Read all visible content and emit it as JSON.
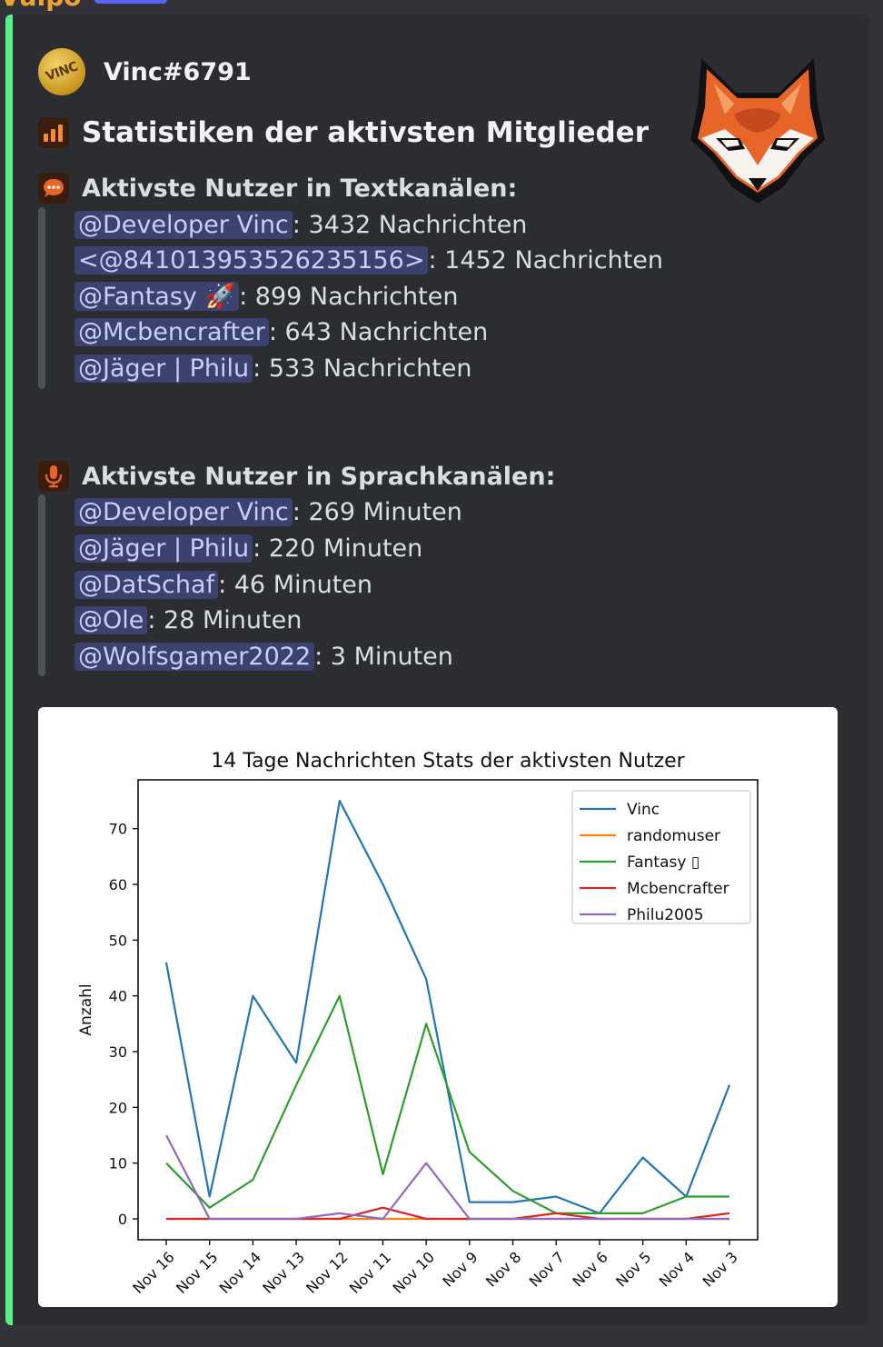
{
  "author": {
    "name": "Vinc#6791",
    "avatar_text": "VINC"
  },
  "embed": {
    "accent_color": "#57f287",
    "title": "Statistiken der aktivsten Mitglieder",
    "text_section": {
      "heading": "Aktivste Nutzer in Textkanälen:",
      "entries": [
        {
          "mention": "@Developer Vinc",
          "value": ": 3432 Nachrichten"
        },
        {
          "mention": "<@841013953526235156>",
          "value": ": 1452 Nachrichten"
        },
        {
          "mention": "@Fantasy 🚀",
          "value": ": 899 Nachrichten"
        },
        {
          "mention": "@Mcbencrafter",
          "value": ": 643 Nachrichten"
        },
        {
          "mention": "@Jäger | Philu",
          "value": ": 533 Nachrichten"
        }
      ]
    },
    "voice_section": {
      "heading": "Aktivste Nutzer in Sprachkanälen:",
      "entries": [
        {
          "mention": "@Developer Vinc",
          "value": ": 269 Minuten"
        },
        {
          "mention": "@Jäger | Philu",
          "value": ": 220 Minuten"
        },
        {
          "mention": "@DatSchaf",
          "value": ": 46 Minuten"
        },
        {
          "mention": "@Ole",
          "value": ": 28 Minuten"
        },
        {
          "mention": "@Wolfsgamer2022",
          "value": ": 3 Minuten"
        }
      ]
    }
  },
  "chart_data": {
    "type": "line",
    "title": "14 Tage Nachrichten Stats der aktivsten Nutzer",
    "xlabel": "",
    "ylabel": "Anzahl",
    "categories": [
      "Nov 16",
      "Nov 15",
      "Nov 14",
      "Nov 13",
      "Nov 12",
      "Nov 11",
      "Nov 10",
      "Nov 9",
      "Nov 8",
      "Nov 7",
      "Nov 6",
      "Nov 5",
      "Nov 4",
      "Nov 3"
    ],
    "yticks": [
      0,
      10,
      20,
      30,
      40,
      50,
      60,
      70
    ],
    "ylim": [
      -3.75,
      78.75
    ],
    "legend_position": "top-right",
    "grid": false,
    "series": [
      {
        "name": "Vinc",
        "color": "#1f77b4",
        "values": [
          46,
          4,
          40,
          28,
          75,
          60,
          43,
          3,
          3,
          4,
          1,
          11,
          4,
          24
        ]
      },
      {
        "name": "randomuser",
        "color": "#ff7f0e",
        "values": [
          0,
          0,
          0,
          0,
          0,
          0,
          0,
          0,
          0,
          0,
          0,
          0,
          0,
          0
        ]
      },
      {
        "name": "Fantasy ▯",
        "color": "#2ca02c",
        "values": [
          10,
          2,
          7,
          24,
          40,
          8,
          35,
          12,
          5,
          1,
          1,
          1,
          4,
          4
        ]
      },
      {
        "name": "Mcbencrafter",
        "color": "#d62728",
        "values": [
          0,
          0,
          0,
          0,
          0,
          2,
          0,
          0,
          0,
          1,
          0,
          0,
          0,
          1
        ]
      },
      {
        "name": "Philu2005",
        "color": "#9467bd",
        "values": [
          15,
          0,
          0,
          0,
          1,
          0,
          10,
          0,
          0,
          0,
          0,
          0,
          0,
          0
        ]
      }
    ]
  }
}
